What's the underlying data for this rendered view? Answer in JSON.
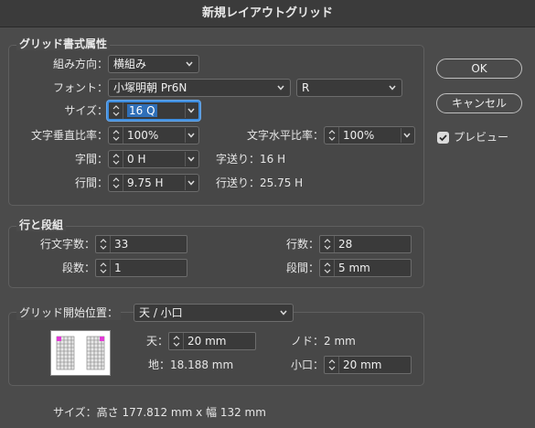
{
  "window": {
    "title": "新規レイアウトグリッド"
  },
  "grid_attributes": {
    "legend": "グリッド書式属性",
    "direction": {
      "label": "組み方向：",
      "value": "横組み"
    },
    "font": {
      "label": "フォント：",
      "family": "小塚明朝 Pr6N",
      "style": "R"
    },
    "size": {
      "label": "サイズ：",
      "value": "16 Q"
    },
    "vertical_scale": {
      "label": "文字垂直比率：",
      "value": "100%"
    },
    "horizontal_scale": {
      "label": "文字水平比率：",
      "value": "100%"
    },
    "char_aki": {
      "label": "字間：",
      "value": "0 H"
    },
    "char_advance": "字送り：16 H",
    "line_gap": {
      "label": "行間：",
      "value": "9.75 H"
    },
    "line_advance": "行送り：25.75 H"
  },
  "lines_columns": {
    "legend": "行と段組",
    "chars_per_line": {
      "label": "行文字数：",
      "value": "33"
    },
    "lines": {
      "label": "行数：",
      "value": "28"
    },
    "columns": {
      "label": "段数：",
      "value": "1"
    },
    "gutter": {
      "label": "段間：",
      "value": "5 mm"
    }
  },
  "start_position": {
    "label": "グリッド開始位置：",
    "value": "天 / 小口",
    "top": {
      "label": "天：",
      "value": "20 mm"
    },
    "inside": "ノド：2 mm",
    "bottom": "地：18.188 mm",
    "outside": {
      "label": "小口：",
      "value": "20 mm"
    }
  },
  "footer": {
    "size_text": "サイズ：高さ 177.812 mm x 幅 132 mm"
  },
  "buttons": {
    "ok": "OK",
    "cancel": "キャンセル"
  },
  "preview": {
    "label": "プレビュー",
    "checked": true
  }
}
